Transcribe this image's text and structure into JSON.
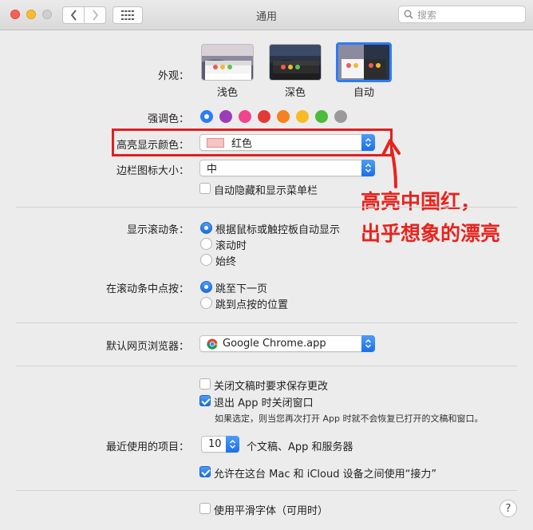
{
  "window": {
    "title": "通用",
    "search_placeholder": "搜索"
  },
  "appearance": {
    "label": "外观：",
    "options": [
      {
        "name": "浅色",
        "selected": false
      },
      {
        "name": "深色",
        "selected": false
      },
      {
        "name": "自动",
        "selected": true
      }
    ]
  },
  "accent": {
    "label": "强调色：",
    "colors": [
      "#2a7cf6",
      "#9b3db7",
      "#f0448f",
      "#e23a36",
      "#f5821f",
      "#f8bb28",
      "#4cbb3b",
      "#9a9a9a"
    ],
    "selected_index": 0
  },
  "highlight": {
    "label": "高亮显示颜色：",
    "value": "红色",
    "chip_color": "#f7c3c3"
  },
  "sidebar_icon": {
    "label": "边栏图标大小：",
    "value": "中"
  },
  "menubar": {
    "label": "自动隐藏和显示菜单栏",
    "checked": false
  },
  "scrollbars": {
    "label": "显示滚动条：",
    "options": [
      "根据鼠标或触控板自动显示",
      "滚动时",
      "始终"
    ],
    "selected_index": 0
  },
  "click_scroll": {
    "label": "在滚动条中点按：",
    "options": [
      "跳至下一页",
      "跳到点按的位置"
    ],
    "selected_index": 0
  },
  "browser": {
    "label": "默认网页浏览器：",
    "value": "Google Chrome.app"
  },
  "documents": {
    "ask_keep": {
      "label": "关闭文稿时要求保存更改",
      "checked": false
    },
    "close_windows": {
      "label": "退出 App 时关闭窗口",
      "checked": true
    },
    "note": "如果选定，则当您再次打开 App 时就不会恢复已打开的文稿和窗口。"
  },
  "recent": {
    "label": "最近使用的项目：",
    "value": "10",
    "suffix": "个文稿、App 和服务器"
  },
  "handoff": {
    "label": "允许在这台 Mac 和 iCloud 设备之间使用“接力”",
    "checked": true
  },
  "font_smoothing": {
    "label": "使用平滑字体（可用时）",
    "checked": false
  },
  "annotation": {
    "line1": "高亮中国红，",
    "line2": "出乎想象的漂亮",
    "color": "#e8231d"
  },
  "help_label": "?"
}
